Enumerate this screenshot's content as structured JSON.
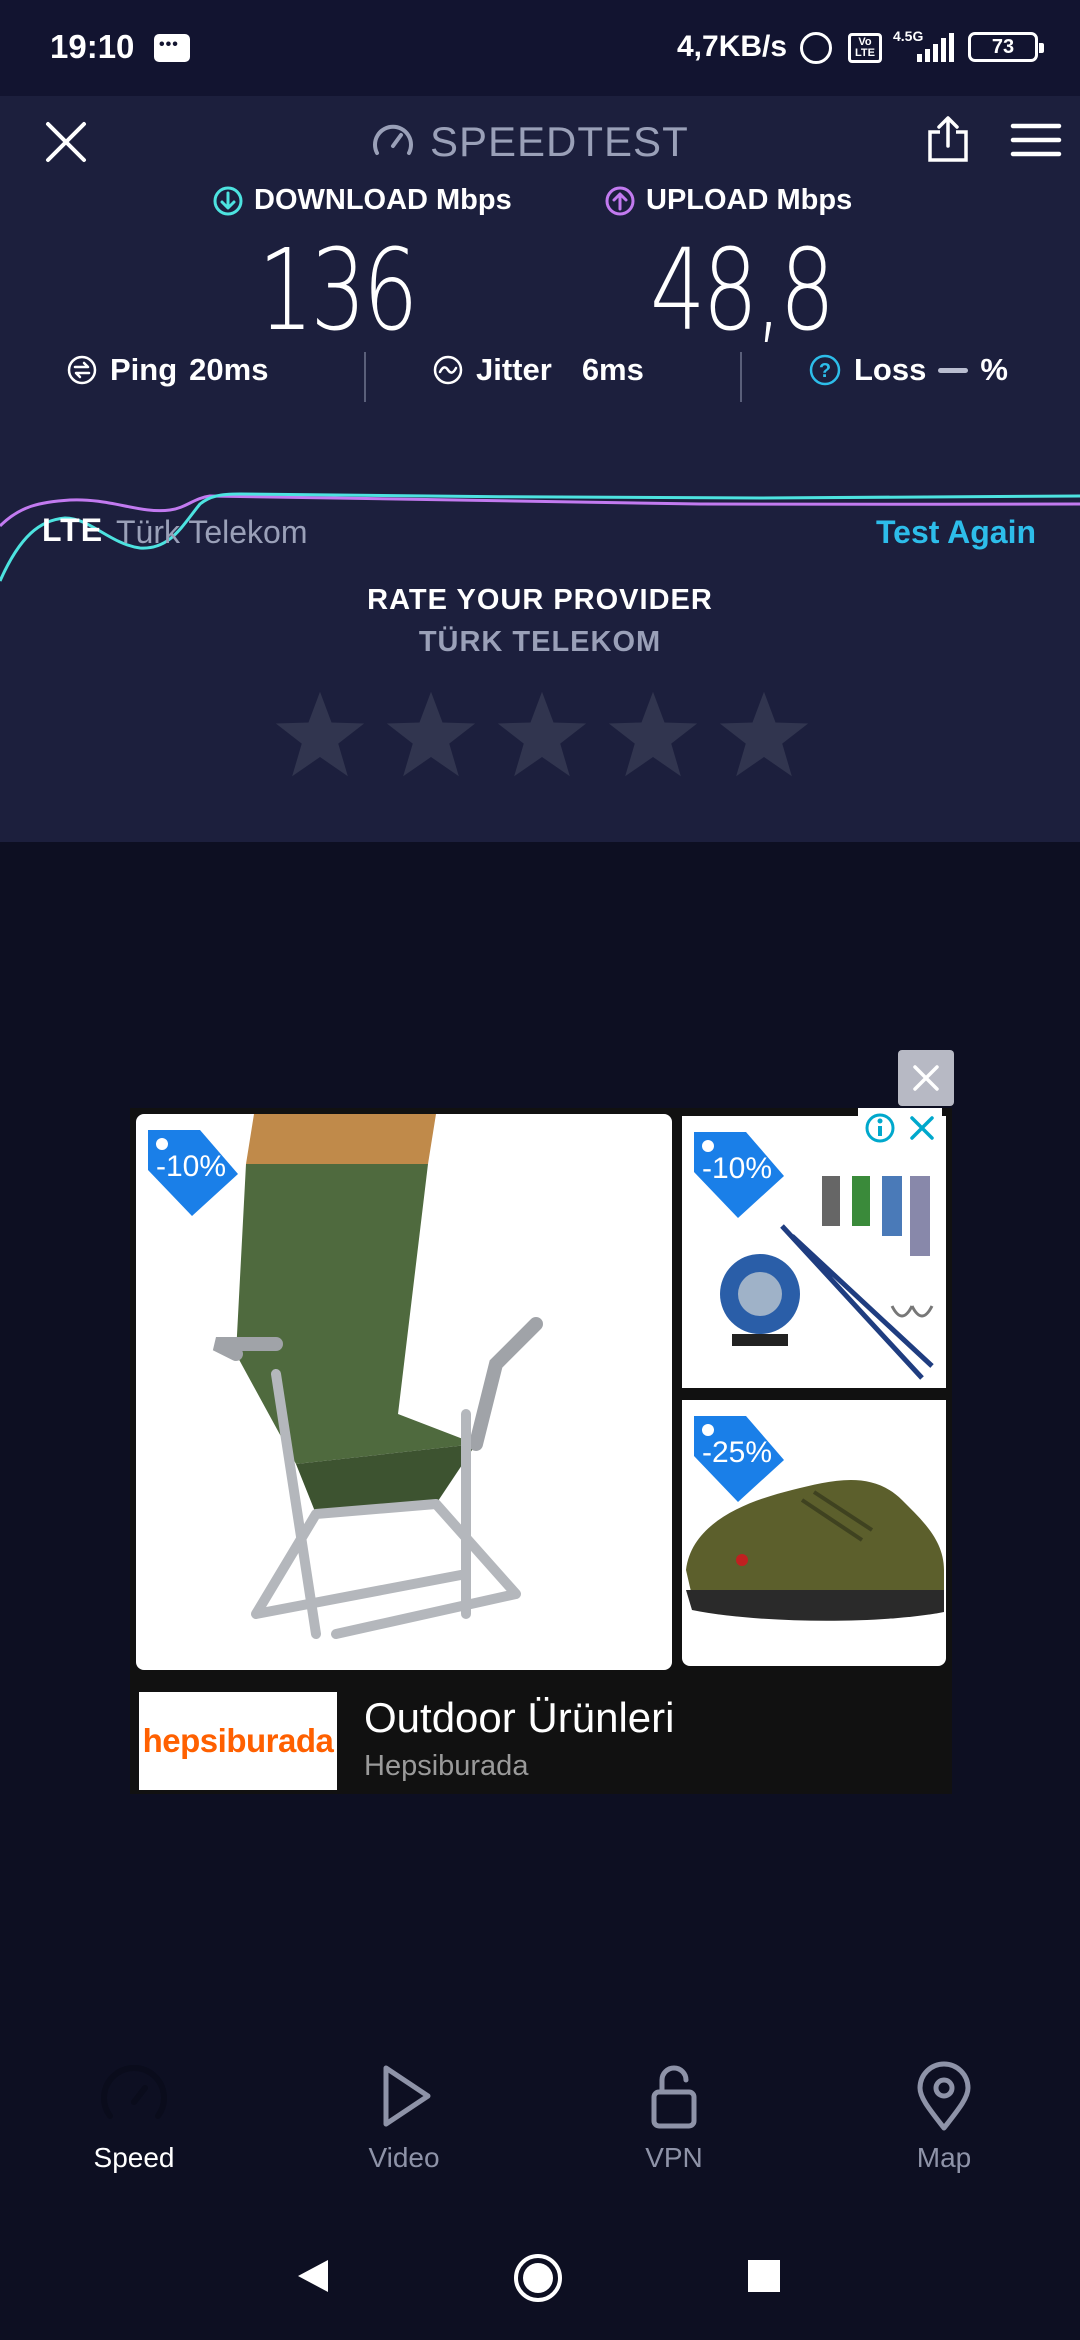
{
  "status_bar": {
    "time": "19:10",
    "net_speed": "4,7KB/s",
    "volte": "Vo LTE",
    "network": "4.5G",
    "battery": "73"
  },
  "header": {
    "brand": "SPEEDTEST"
  },
  "results": {
    "download_label": "DOWNLOAD Mbps",
    "download_value": "136",
    "upload_label": "UPLOAD Mbps",
    "upload_value": "48,8",
    "ping_label": "Ping",
    "ping_value": "20ms",
    "jitter_label": "Jitter",
    "jitter_value": "6ms",
    "loss_label": "Loss",
    "loss_value": "%",
    "colors": {
      "download": "#4de3e0",
      "upload": "#c27af0"
    }
  },
  "connection": {
    "type": "LTE",
    "provider": "Türk Telekom",
    "test_again": "Test Again"
  },
  "rating": {
    "title": "RATE YOUR PROVIDER",
    "provider": "TÜRK TELEKOM",
    "star_count": 5
  },
  "ad": {
    "tags": [
      "-10%",
      "-10%",
      "-25%"
    ],
    "logo_text": "hepsiburada",
    "title": "Outdoor Ürünleri",
    "advertiser": "Hepsiburada"
  },
  "bottom_nav": {
    "items": [
      {
        "label": "Speed",
        "icon": "speedometer-icon",
        "active": true
      },
      {
        "label": "Video",
        "icon": "play-icon",
        "active": false
      },
      {
        "label": "VPN",
        "icon": "unlock-icon",
        "active": false
      },
      {
        "label": "Map",
        "icon": "map-pin-icon",
        "active": false
      }
    ]
  }
}
